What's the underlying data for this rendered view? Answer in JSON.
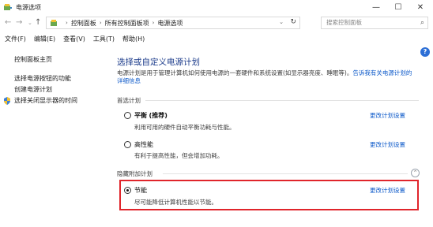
{
  "window": {
    "title": "电源选项",
    "minimize": "—",
    "maximize": "☐",
    "close": "✕"
  },
  "nav": {
    "back": "←",
    "forward": "→",
    "recent": "⌄",
    "up": "↑",
    "breadcrumbs": [
      "控制面板",
      "所有控制面板项",
      "电源选项"
    ],
    "search_placeholder": "搜索控制面板"
  },
  "menu": [
    "文件(F)",
    "编辑(E)",
    "查看(V)",
    "工具(T)",
    "帮助(H)"
  ],
  "left": {
    "home": "控制面板主页",
    "links": [
      "选择电源按钮的功能",
      "创建电源计划",
      "选择关闭显示器的时间"
    ]
  },
  "main": {
    "heading": "选择或自定义电源计划",
    "description": "电源计划是用于管理计算机如何使用电源的一套硬件和系统设置(如显示器亮度、睡眠等)。",
    "description_link": "告诉我有关电源计划的详细信息",
    "preferred_label": "首选计划",
    "hidden_label": "隐藏附加计划",
    "change_link": "更改计划设置",
    "plans": [
      {
        "name": "平衡",
        "tag": "(推荐)",
        "desc": "利用可用的硬件自动平衡功耗与性能。",
        "checked": false
      },
      {
        "name": "高性能",
        "tag": "",
        "desc": "有利于提高性能，但会增加功耗。",
        "checked": false
      },
      {
        "name": "节能",
        "tag": "",
        "desc": "尽可能降低计算机性能以节能。",
        "checked": true
      }
    ]
  },
  "colors": {
    "heading": "#1a3a8a",
    "link": "#0b58c9",
    "highlight": "#e0252b"
  }
}
